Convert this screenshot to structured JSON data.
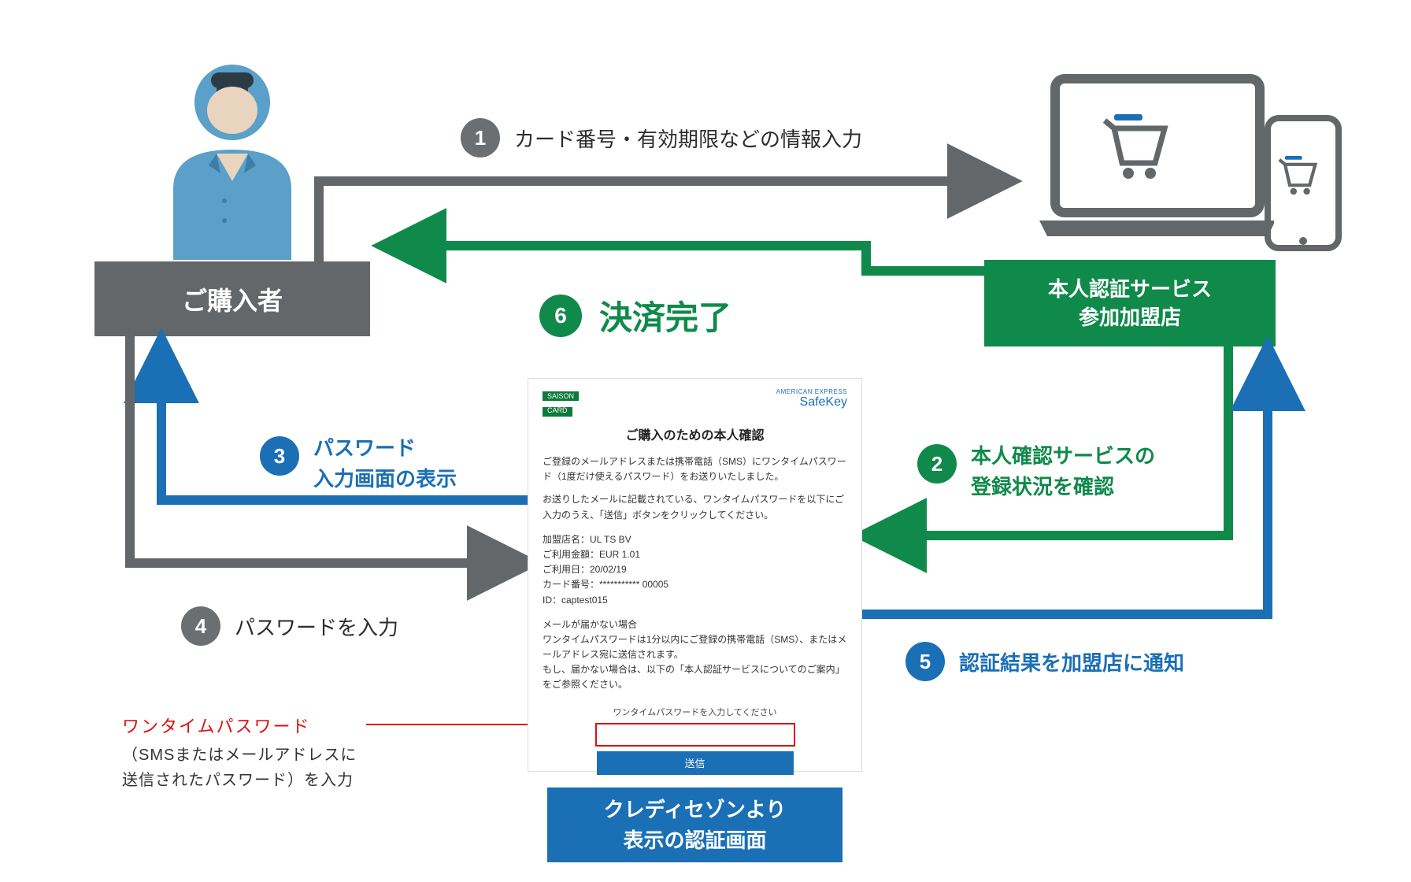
{
  "buyer_label": "ご購入者",
  "merchant_label": "本人認証サービス\n参加加盟店",
  "steps": {
    "s1": {
      "num": "1",
      "text": "カード番号・有効期限などの情報入力"
    },
    "s2": {
      "num": "2",
      "text_l1": "本人確認サービスの",
      "text_l2": "登録状況を確認"
    },
    "s3": {
      "num": "3",
      "text_l1": "パスワード",
      "text_l2": "入力画面の表示"
    },
    "s4": {
      "num": "4",
      "text": "パスワードを入力"
    },
    "s5": {
      "num": "5",
      "text": "認証結果を加盟店に通知"
    },
    "s6": {
      "num": "6",
      "text": "決済完了"
    }
  },
  "panel": {
    "saison_top": "SAISON",
    "saison_bottom": "CARD",
    "safekey_top": "AMERICAN EXPRESS",
    "safekey": "SafeKey",
    "title": "ご購入のための本人確認",
    "p1": "ご登録のメールアドレスまたは携帯電話（SMS）にワンタイムパスワード（1度だけ使えるパスワード）をお送りいたしました。",
    "p2": "お送りしたメールに記載されている、ワンタイムパスワードを以下にご入力のうえ、「送信」ボタンをクリックしてください。",
    "d1": "加盟店名：UL TS BV",
    "d2": "ご利用金額：EUR 1.01",
    "d3": "ご利用日：20/02/19",
    "d4": "カード番号：*********** 00005",
    "d5": "ID：captest015",
    "n1": "メールが届かない場合",
    "n2": "ワンタイムパスワードは1分以内にご登録の携帯電話（SMS）、またはメールアドレス宛に送信されます。",
    "n3": "もし、届かない場合は、以下の「本人認証サービスについてのご案内」をご参照ください。",
    "otp_label": "ワンタイムパスワードを入力してください",
    "send": "送信"
  },
  "caption_box": "クレディセゾンより\n表示の認証画面",
  "otp_callout": {
    "title": "ワンタイムパスワード",
    "sub": "（SMSまたはメールアドレスに\n送信されたパスワード）を入力"
  }
}
